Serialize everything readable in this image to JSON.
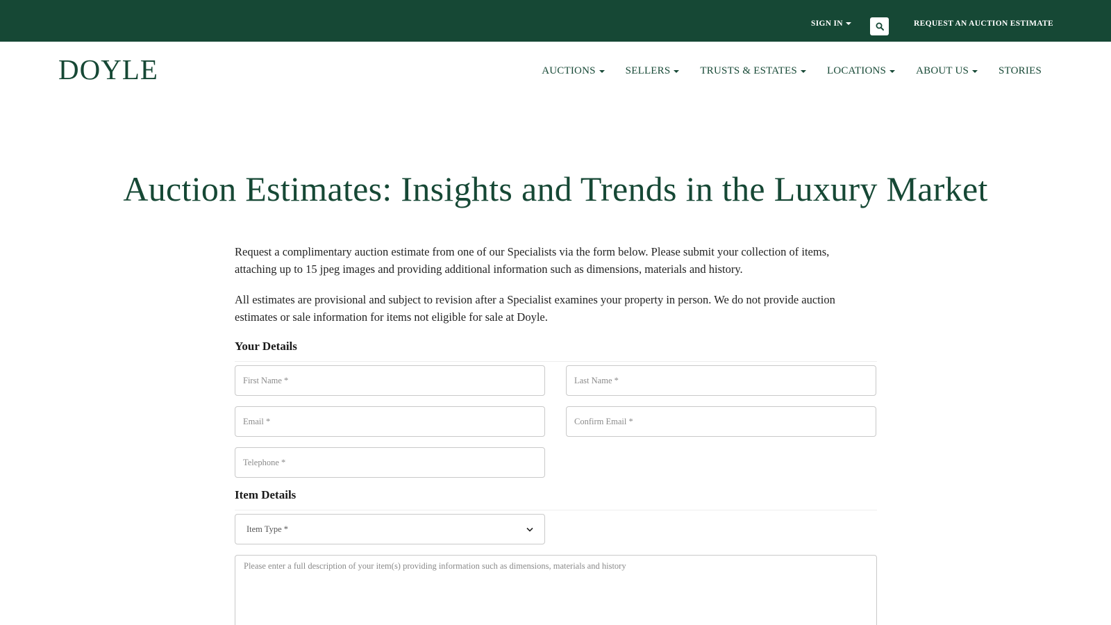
{
  "topbar": {
    "sign_in": "SIGN IN",
    "search_icon": "search-icon",
    "request_estimate": "REQUEST AN AUCTION ESTIMATE"
  },
  "header": {
    "logo": "DOYLE",
    "nav": [
      {
        "label": "AUCTIONS"
      },
      {
        "label": "SELLERS"
      },
      {
        "label": "TRUSTS & ESTATES"
      },
      {
        "label": "LOCATIONS"
      },
      {
        "label": "ABOUT US"
      },
      {
        "label": "STORIES"
      }
    ]
  },
  "main": {
    "title": "Auction Estimates: Insights and Trends in the Luxury Market",
    "intro_1": "Request a complimentary auction estimate from one of our Specialists via the form below. Please submit your collection of items, attaching up to 15 jpeg images and providing additional information such as dimensions, materials and history.",
    "intro_2": "All estimates are provisional and subject to revision after a Specialist examines your property in person. We do not provide auction estimates or sale information for items not eligible for sale at Doyle."
  },
  "form": {
    "your_details_heading": "Your Details",
    "first_name_placeholder": "First Name *",
    "last_name_placeholder": "Last Name *",
    "email_placeholder": "Email *",
    "confirm_email_placeholder": "Confirm Email *",
    "telephone_placeholder": "Telephone *",
    "item_details_heading": "Item Details",
    "item_type_selected": "Item Type *",
    "description_placeholder": "Please enter a full description of your item(s) providing information such as dimensions, materials and history"
  },
  "colors": {
    "brand_green": "#164835",
    "white": "#ffffff"
  }
}
